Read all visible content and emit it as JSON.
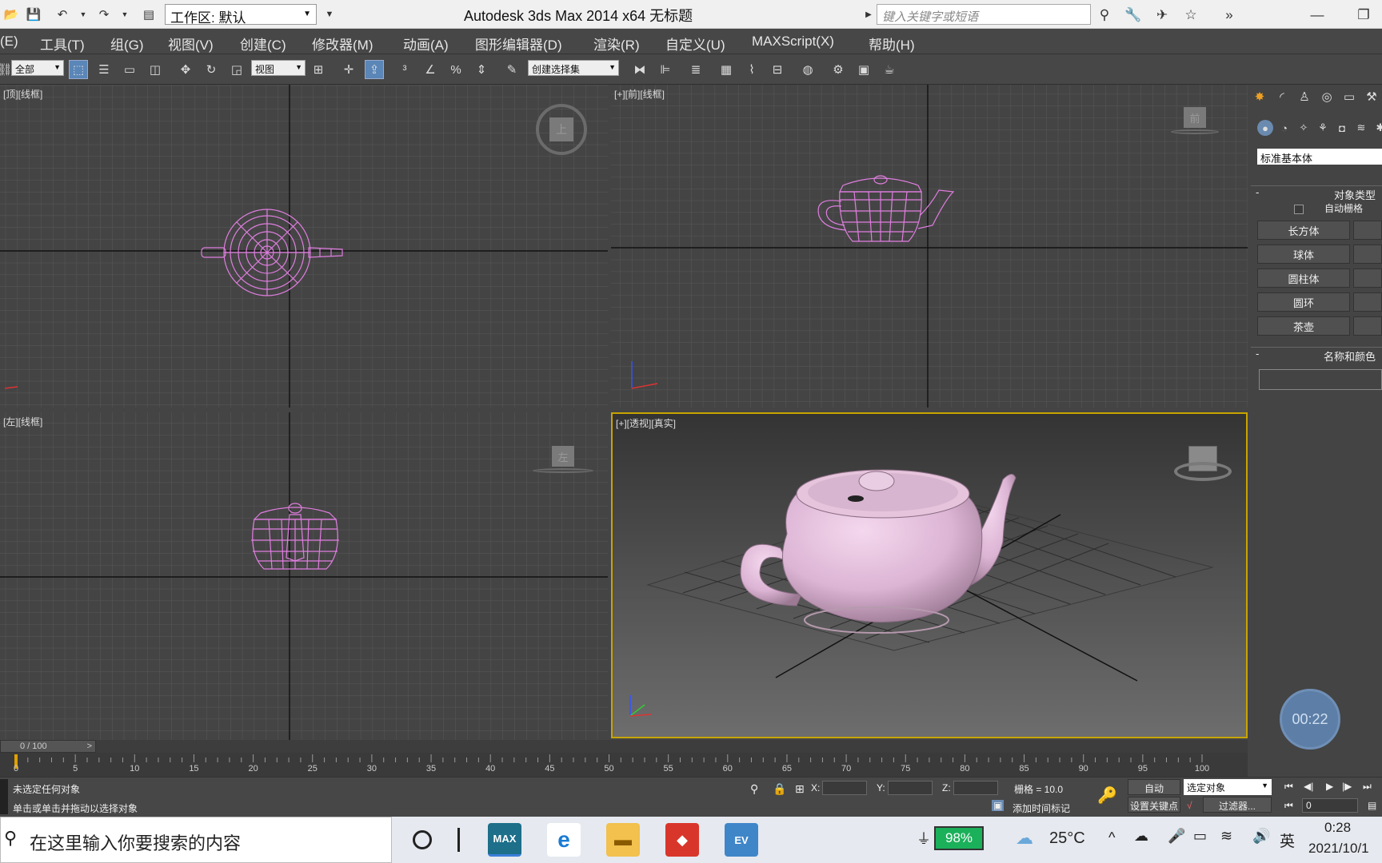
{
  "titlebar": {
    "workspace_label": "工作区: 默认",
    "app_title": "Autodesk 3ds Max  2014 x64     无标题",
    "search_placeholder": "键入关键字或短语"
  },
  "menu": [
    "(E)",
    "工具(T)",
    "组(G)",
    "视图(V)",
    "创建(C)",
    "修改器(M)",
    "动画(A)",
    "图形编辑器(D)",
    "渲染(R)",
    "自定义(U)",
    "MAXScript(X)",
    "帮助(H)"
  ],
  "toolbar": {
    "filter_select": "全部",
    "ref_coord_select": "视图",
    "selection_set": "创建选择集"
  },
  "viewports": {
    "top": {
      "label": "[顶][线框]",
      "cube_face": "上"
    },
    "front": {
      "label": "[+][前][线框]",
      "cube_face": "前"
    },
    "left": {
      "label": "[左][线框]",
      "cube_face": "左"
    },
    "perspective": {
      "label": "[+][透视][真实]"
    }
  },
  "command_panel": {
    "category_dropdown": "标准基本体",
    "object_type_title": "对象类型",
    "autogrid_label": "自动栅格",
    "primitives": [
      "长方体",
      "球体",
      "圆柱体",
      "圆环",
      "茶壶"
    ],
    "name_color_title": "名称和颜色"
  },
  "timeline": {
    "frame_display": "0 / 100",
    "ticks": [
      "0",
      "5",
      "10",
      "15",
      "20",
      "25",
      "30",
      "35",
      "40",
      "45",
      "50",
      "55",
      "60",
      "65",
      "70",
      "75",
      "80",
      "85",
      "90",
      "95",
      "100"
    ]
  },
  "status": {
    "selection_status": "未选定任何对象",
    "prompt": "单击或单击并拖动以选择对象",
    "x_label": "X:",
    "y_label": "Y:",
    "z_label": "Z:",
    "grid_label": "栅格 = 10.0",
    "add_time_tag": "添加时间标记",
    "auto_key": "自动",
    "selected_dropdown": "选定对象",
    "set_key": "设置关键点",
    "filters": "过滤器...",
    "current_frame": "0"
  },
  "timer_overlay": "00:22",
  "taskbar": {
    "search_placeholder": "在这里输入你要搜索的内容",
    "battery": "98%",
    "temperature": "25°C",
    "ime": "英",
    "time": "0:28",
    "date": "2021/10/1"
  }
}
